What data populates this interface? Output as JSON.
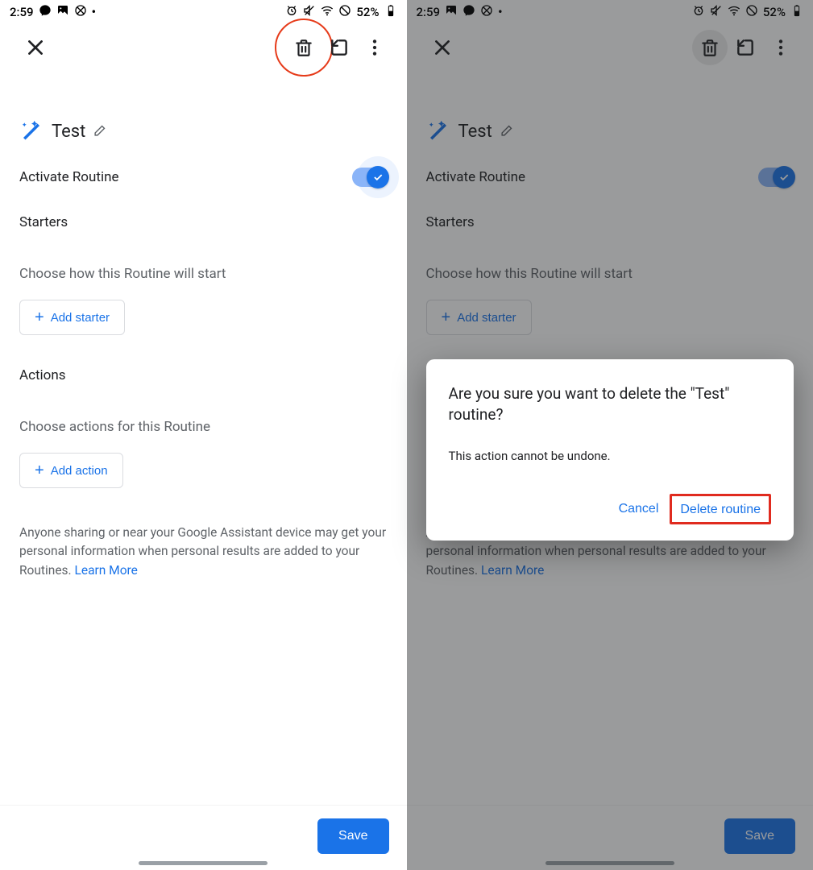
{
  "status": {
    "time": "2:59",
    "battery": "52%"
  },
  "routine": {
    "title": "Test",
    "activate_label": "Activate Routine",
    "starters_label": "Starters",
    "starters_sub": "Choose how this Routine will start",
    "add_starter": "Add starter",
    "actions_label": "Actions",
    "actions_sub": "Choose actions for this Routine",
    "add_action": "Add action",
    "disclaimer_text": "Anyone sharing or near your Google Assistant device may get your personal information when personal results are added to your Routines. ",
    "learn_more": "Learn More",
    "save": "Save"
  },
  "dialog": {
    "title": "Are you sure you want to delete the \"Test\" routine?",
    "message": "This action cannot be undone.",
    "cancel": "Cancel",
    "delete": "Delete routine"
  }
}
